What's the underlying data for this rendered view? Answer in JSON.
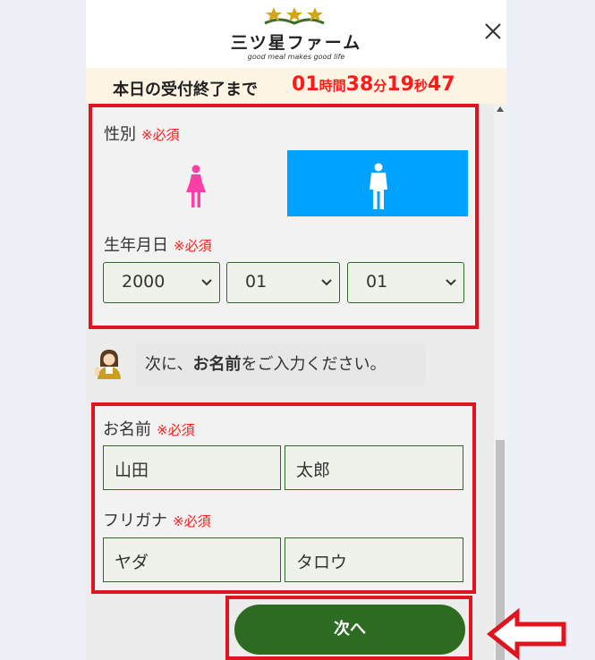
{
  "header": {
    "brand": "三ツ星ファーム",
    "tagline": "good meal makes good life"
  },
  "timer": {
    "label": "本日の受付終了まで",
    "hours": "01",
    "hours_unit": "時間",
    "minutes": "38",
    "minutes_unit": "分",
    "seconds": "19",
    "seconds_unit": "秒",
    "centis": "47"
  },
  "form": {
    "gender": {
      "label": "性別",
      "required": "※必須",
      "selected": "male"
    },
    "birthdate": {
      "label": "生年月日",
      "required": "※必須",
      "year": "2000",
      "month": "01",
      "day": "01"
    },
    "prompt": {
      "prefix": "次に、",
      "bold": "お名前",
      "suffix": "をご入力ください。"
    },
    "name": {
      "label": "お名前",
      "required": "※必須",
      "last": "山田",
      "first": "太郎"
    },
    "kana": {
      "label": "フリガナ",
      "required": "※必須",
      "last": "ヤダ",
      "first": "タロウ"
    },
    "next_label": "次へ"
  },
  "colors": {
    "accent_green": "#2e6b22",
    "selected_blue": "#00a2ff",
    "required_red": "#ff1a1a",
    "highlight_red": "#e0141e",
    "female_pink": "#ff3ea5"
  }
}
